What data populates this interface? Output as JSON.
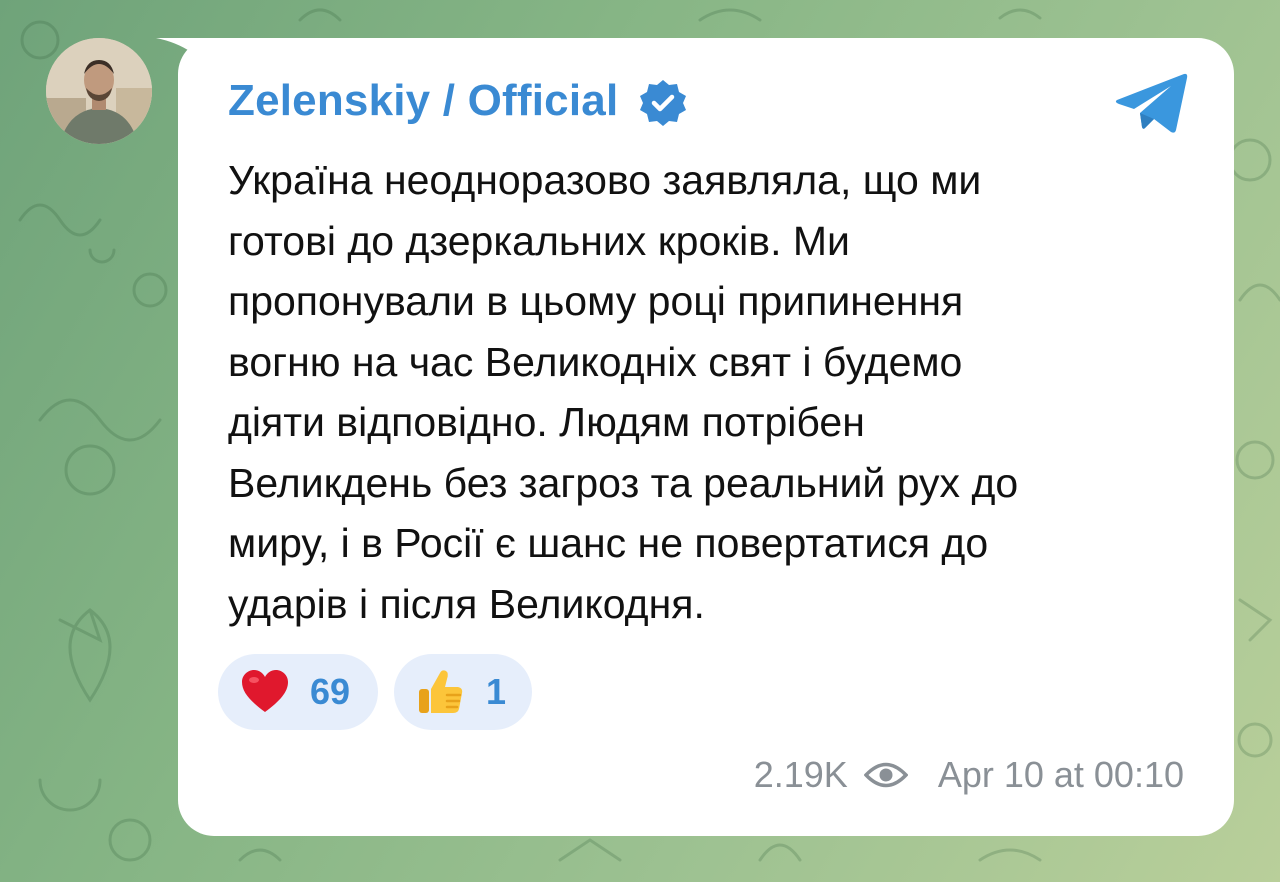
{
  "channel": {
    "name": "Zelenskiy / Official",
    "verified_icon": "verified-badge-icon",
    "app_icon": "telegram-icon",
    "accent_color": "#3a8ad3"
  },
  "message": {
    "lines": [
      "Україна неодноразово заявляла, що ми",
      "готові до дзеркальних кроків. Ми",
      "пропонували в цьому році припинення",
      "вогню на час Великодніх свят і будемо",
      "діяти відповідно. Людям потрібен",
      "Великдень без загроз та реальний рух до",
      "миру, і в Росії є шанс не повертатися до",
      "ударів і після Великодня."
    ]
  },
  "reactions": [
    {
      "icon": "heart-emoji-icon",
      "count": "69"
    },
    {
      "icon": "thumbs-up-emoji-icon",
      "count": "1"
    }
  ],
  "meta": {
    "views": "2.19K",
    "views_icon": "eye-icon",
    "timestamp": "Apr 10 at 00:10"
  },
  "colors": {
    "background": "#86b585",
    "bubble": "#ffffff",
    "reaction_bg": "#e6eefb",
    "meta_text": "#8a9096"
  }
}
